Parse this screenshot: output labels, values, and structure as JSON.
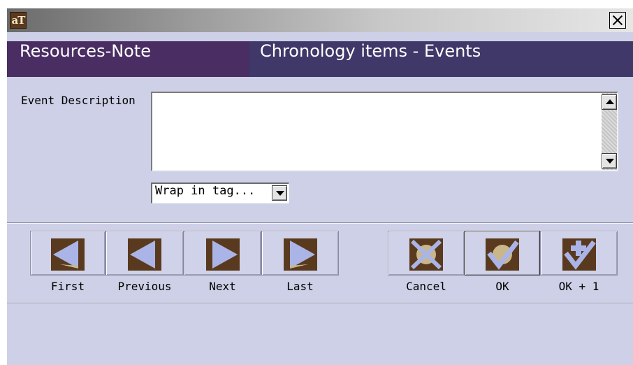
{
  "window": {
    "app_icon_text": "aT",
    "close_icon": "close-icon"
  },
  "header": {
    "left_title": "Resources-Note",
    "right_title": "Chronology items - Events"
  },
  "form": {
    "event_description_label": "Event Description",
    "event_description_value": "",
    "wrap_select_value": "Wrap in tag..."
  },
  "nav_buttons": [
    {
      "label": "First",
      "icon": "first-icon"
    },
    {
      "label": "Previous",
      "icon": "previous-icon"
    },
    {
      "label": "Next",
      "icon": "next-icon"
    },
    {
      "label": "Last",
      "icon": "last-icon"
    }
  ],
  "action_buttons": [
    {
      "label": "Cancel",
      "icon": "cancel-icon"
    },
    {
      "label": "OK",
      "icon": "ok-icon"
    },
    {
      "label": "OK + 1",
      "icon": "ok-plus-one-icon"
    }
  ],
  "colors": {
    "window_bg": "#cdd0e6",
    "header_left": "#4a2d63",
    "header_right": "#3f3869",
    "icon_brown": "#5a3a1e",
    "icon_accent": "#aab4e6"
  }
}
